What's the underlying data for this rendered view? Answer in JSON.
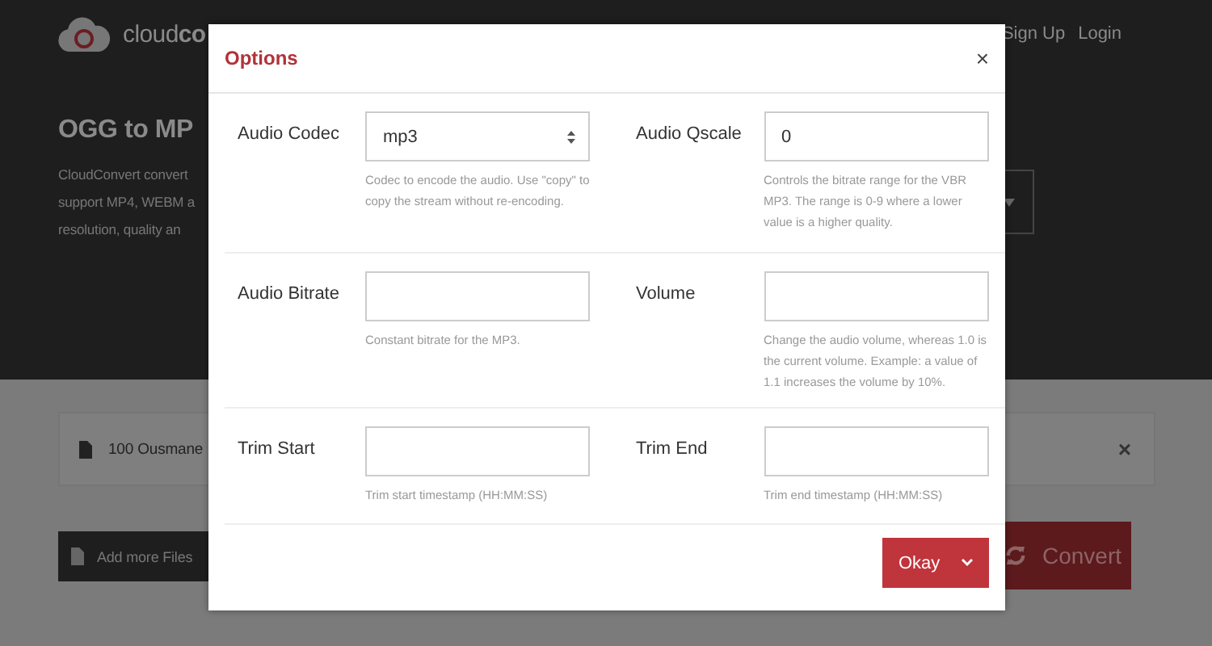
{
  "header": {
    "logo_text": "cloud",
    "logo_bold": "co",
    "nav": [
      "Sign Up",
      "Login"
    ]
  },
  "hero": {
    "title": "OGG to MP",
    "lines": [
      "CloudConvert convert",
      "support MP4, WEBM a",
      "resolution, quality an"
    ]
  },
  "file_row": {
    "name": "100 Ousmane",
    "remove": "×"
  },
  "add_button": "Add more Files",
  "convert_button": "Convert",
  "dialog": {
    "title": "Options",
    "close": "×",
    "rows": [
      [
        {
          "kind": "select",
          "label": "Audio Codec",
          "value": "mp3",
          "hint": "Codec to encode the audio. Use \"copy\" to copy the stream without re-encoding."
        },
        {
          "kind": "input",
          "label": "Audio Qscale",
          "value": "0",
          "hint": "Controls the bitrate range for the VBR MP3. The range is 0-9 where a lower value is a higher quality."
        }
      ],
      [
        {
          "kind": "input",
          "label": "Audio Bitrate",
          "hint": "Constant bitrate for the MP3."
        },
        {
          "kind": "input",
          "label": "Volume",
          "hint": "Change the audio volume, whereas 1.0 is the current volume. Example: a value of 1.1 increases the volume by 10%."
        }
      ],
      [
        {
          "kind": "input",
          "label": "Trim Start",
          "hint": "Trim start timestamp (HH:MM:SS)"
        },
        {
          "kind": "input",
          "label": "Trim End",
          "hint": "Trim end timestamp (HH:MM:SS)"
        }
      ]
    ],
    "ok_button": "Okay"
  }
}
